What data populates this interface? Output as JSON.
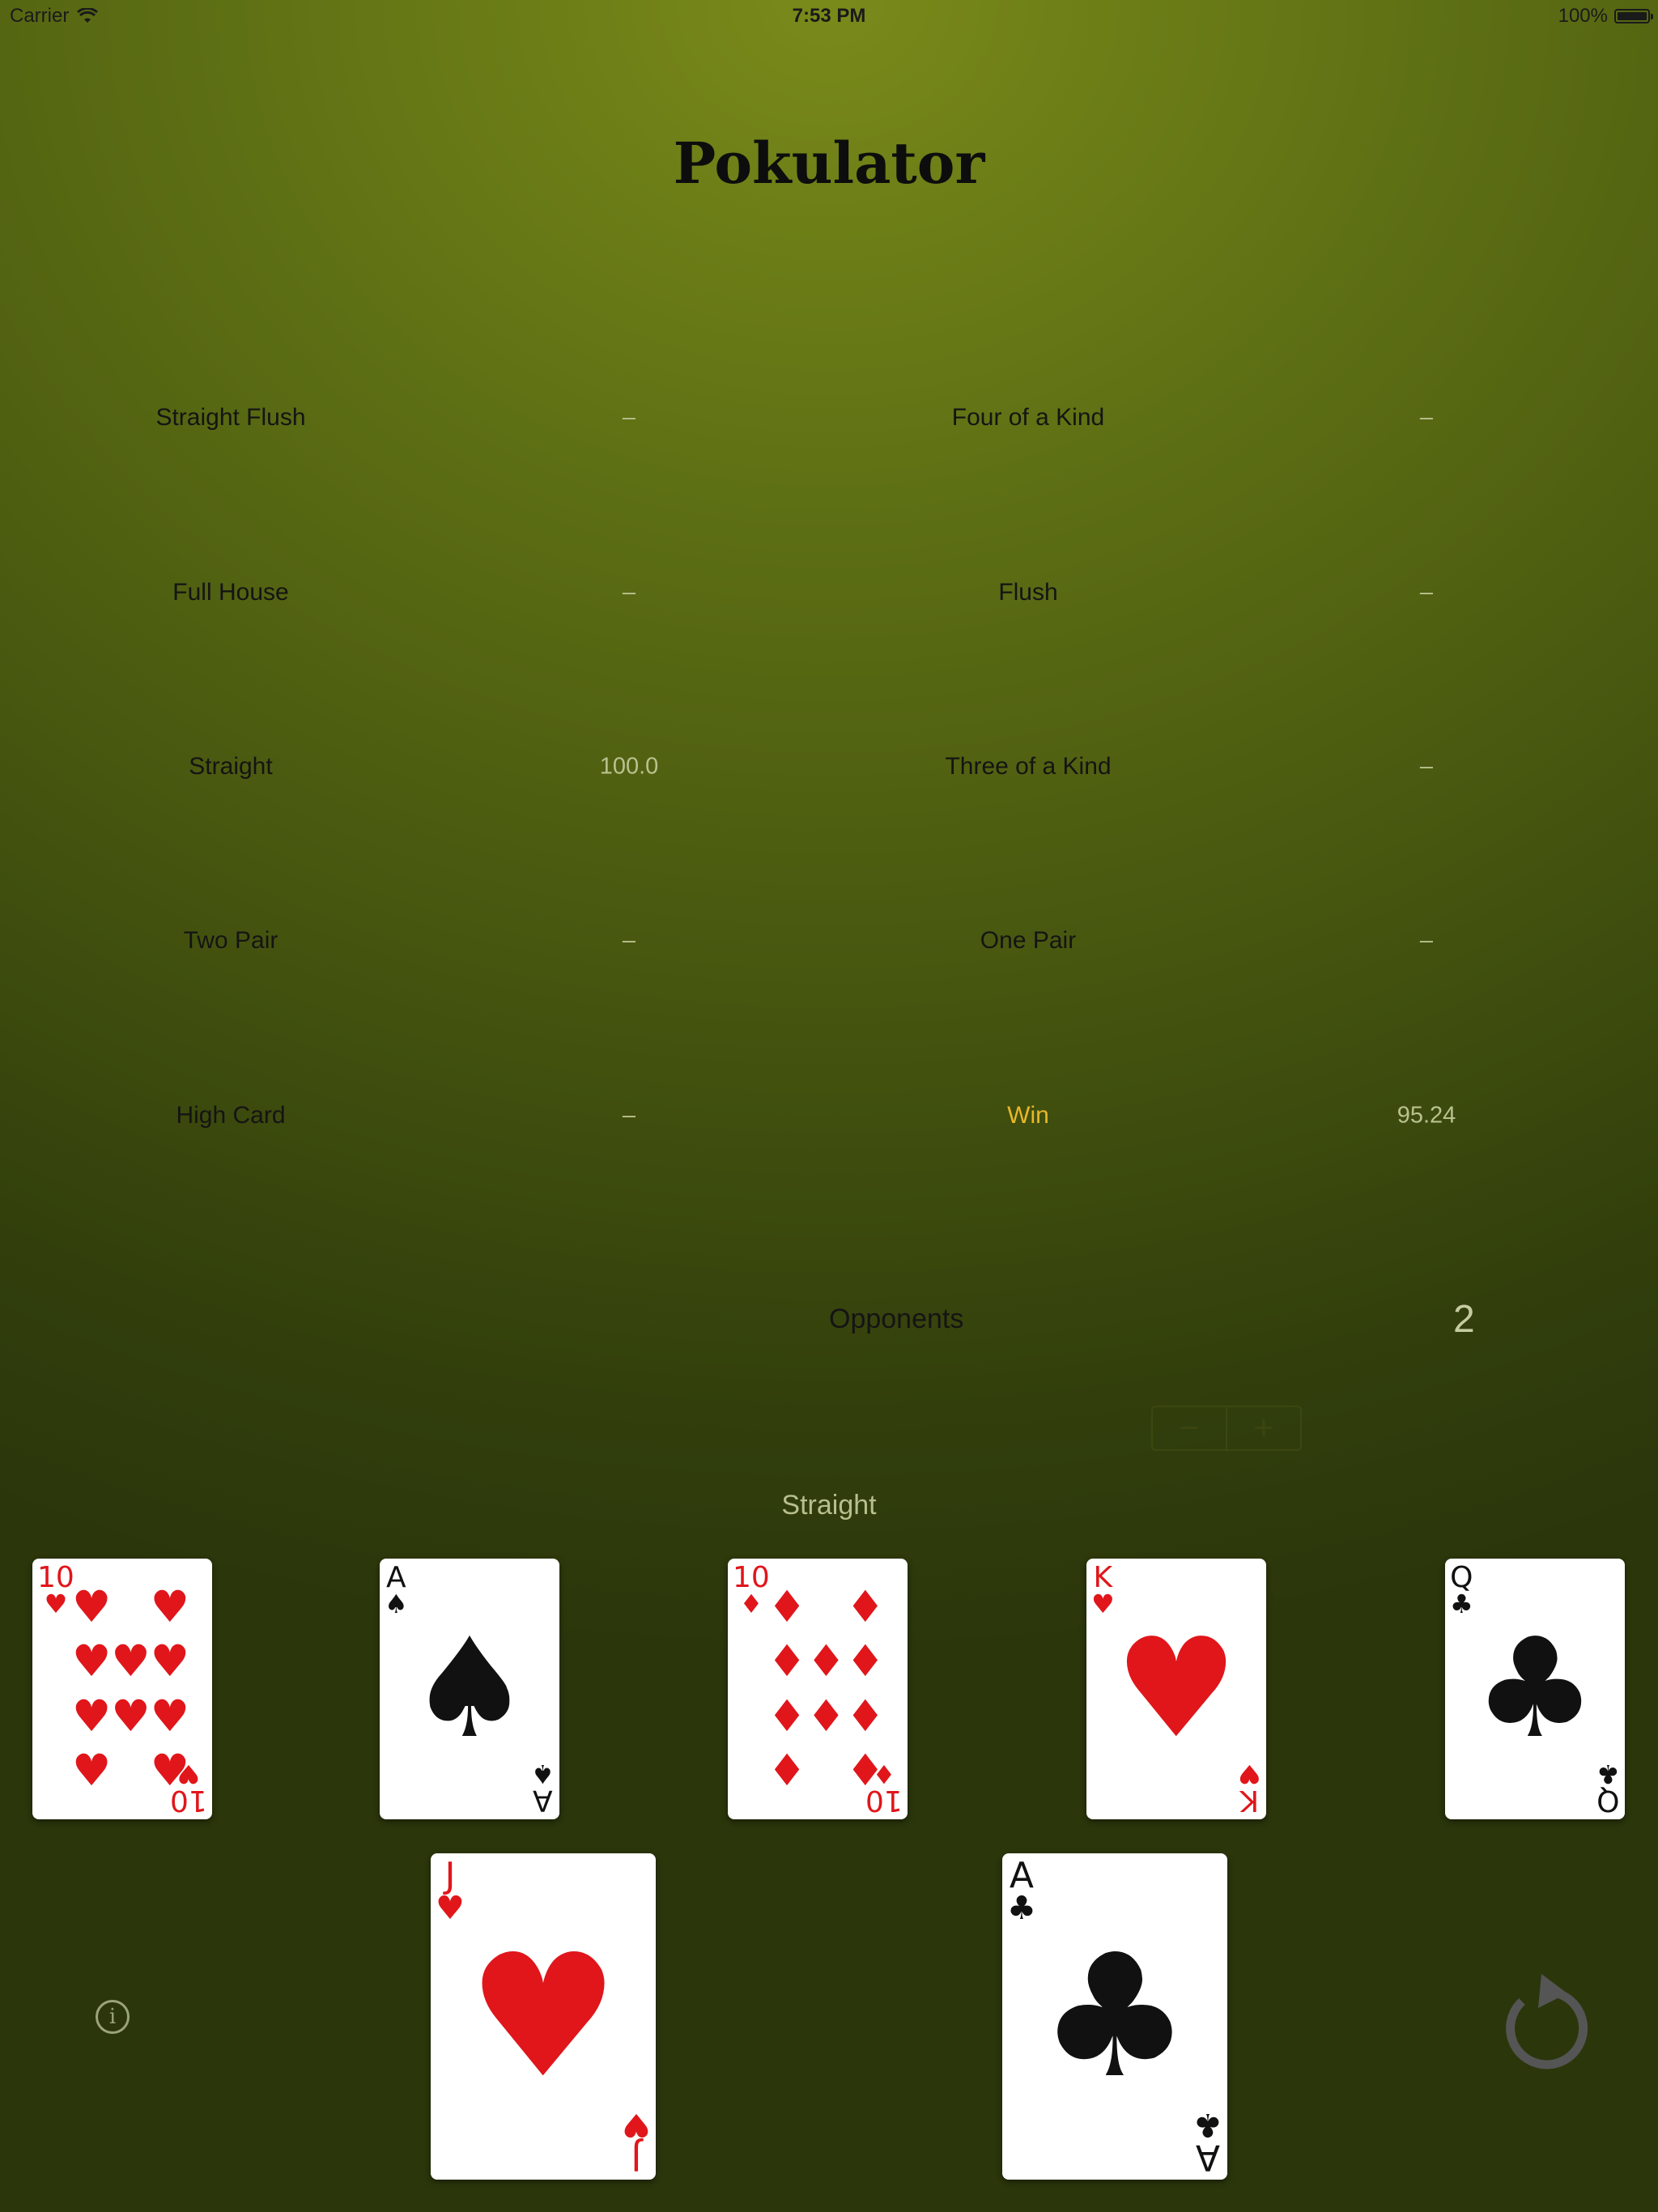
{
  "status_bar": {
    "carrier": "Carrier",
    "time": "7:53 PM",
    "battery": "100%",
    "battery_level": 1.0
  },
  "app": {
    "title": "Pokulator"
  },
  "hands": {
    "straight_flush": {
      "label": "Straight Flush",
      "value": "–"
    },
    "four_of_a_kind": {
      "label": "Four of a Kind",
      "value": "–"
    },
    "full_house": {
      "label": "Full House",
      "value": "–"
    },
    "flush": {
      "label": "Flush",
      "value": "–"
    },
    "straight": {
      "label": "Straight",
      "value": "100.0"
    },
    "three_of_a_kind": {
      "label": "Three of a Kind",
      "value": "–"
    },
    "two_pair": {
      "label": "Two Pair",
      "value": "–"
    },
    "one_pair": {
      "label": "One Pair",
      "value": "–"
    },
    "high_card": {
      "label": "High Card",
      "value": "–"
    },
    "win": {
      "label": "Win",
      "value": "95.24"
    }
  },
  "opponents": {
    "label": "Opponents",
    "count": "2",
    "decrement": "−",
    "increment": "+"
  },
  "current_hand": "Straight",
  "board": [
    {
      "rank": "10",
      "suit": "♥",
      "color": "red"
    },
    {
      "rank": "A",
      "suit": "♠",
      "color": "black"
    },
    {
      "rank": "10",
      "suit": "♦",
      "color": "red"
    },
    {
      "rank": "K",
      "suit": "♥",
      "color": "red"
    },
    {
      "rank": "Q",
      "suit": "♣",
      "color": "black"
    }
  ],
  "hole_cards": [
    {
      "rank": "J",
      "suit": "♥",
      "color": "red"
    },
    {
      "rank": "A",
      "suit": "♣",
      "color": "black"
    }
  ],
  "icons": {
    "info": "info-icon",
    "reset": "reset-icon"
  },
  "colors": {
    "win_label": "#e8b72a",
    "felt": "#5e7014"
  }
}
